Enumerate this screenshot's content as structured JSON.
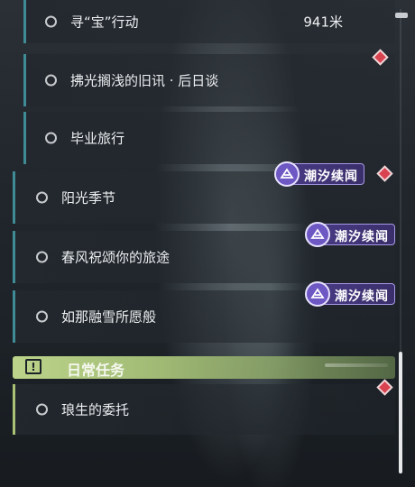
{
  "quests": [
    {
      "title": "寻“宝”行动",
      "distance": "941米"
    },
    {
      "title": "拂光搁浅的旧讯 · 后日谈"
    },
    {
      "title": "毕业旅行"
    },
    {
      "title": "阳光季节",
      "badge": "潮汐续闻"
    },
    {
      "title": "春风祝颂你的旅途",
      "badge": "潮汐续闻"
    },
    {
      "title": "如那融雪所愿般",
      "badge": "潮汐续闻"
    }
  ],
  "daily_section": {
    "title": "日常任务",
    "icon": "exclamation-icon",
    "quests": [
      {
        "title": "琅生的委托"
      }
    ]
  },
  "colors": {
    "quest_accent": "#3f8c96",
    "daily_accent": "#a9c274",
    "tracked_marker": "#d9424f",
    "badge_bg": "#4a3b86"
  }
}
